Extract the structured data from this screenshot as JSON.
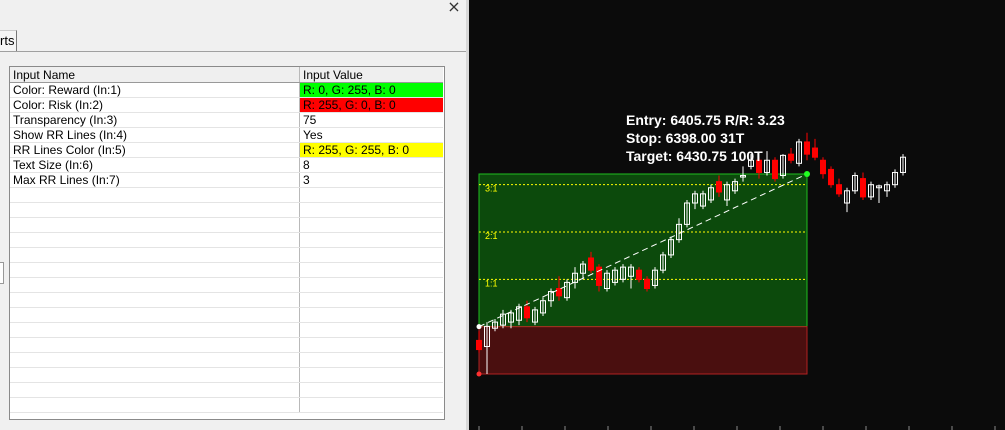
{
  "dialog": {
    "tab_label": "rts",
    "columns": [
      "Input Name",
      "Input Value"
    ],
    "rows": [
      {
        "name": "Color: Reward   (In:1)",
        "value": "R: 0, G: 255, B: 0",
        "bg": "#00ff00"
      },
      {
        "name": "Color: Risk   (In:2)",
        "value": "R: 255, G: 0, B: 0",
        "bg": "#ff0000"
      },
      {
        "name": "Transparency   (In:3)",
        "value": "75",
        "bg": ""
      },
      {
        "name": "Show RR Lines   (In:4)",
        "value": "Yes",
        "bg": ""
      },
      {
        "name": "RR Lines Color   (In:5)",
        "value": "R: 255, G: 255, B: 0",
        "bg": "#ffff00"
      },
      {
        "name": "Text Size   (In:6)",
        "value": "8",
        "bg": ""
      },
      {
        "name": "Max RR Lines   (In:7)",
        "value": "3",
        "bg": ""
      }
    ],
    "close_glyph": "×"
  },
  "chart": {
    "info_lines": [
      "Entry: 6405.75  R/R: 3.23",
      "Stop: 6398.00  31T",
      "Target: 6430.75  100T"
    ],
    "rr_labels": [
      "3:1",
      "2:1",
      "1:1"
    ],
    "entry": 6405.75,
    "stop": 6398.0,
    "target": 6430.75,
    "colors": {
      "reward_fill": "#0c4a0c",
      "reward_border": "#1fbf1f",
      "risk_fill": "#4a0f0f",
      "risk_border": "#b22020",
      "rr_line": "#ffff00",
      "up_candle": "#ffffff",
      "down_candle": "#ff0000",
      "background": "#0b0b0b"
    },
    "candles": [
      {
        "o": 6403.5,
        "h": 6405.0,
        "l": 6401.5,
        "c": 6402.0
      },
      {
        "o": 6402.5,
        "h": 6406.5,
        "l": 6398.0,
        "c": 6405.8
      },
      {
        "o": 6405.5,
        "h": 6407.0,
        "l": 6405.0,
        "c": 6406.5
      },
      {
        "o": 6406.0,
        "h": 6408.5,
        "l": 6405.5,
        "c": 6407.8
      },
      {
        "o": 6406.5,
        "h": 6408.5,
        "l": 6405.5,
        "c": 6408.0
      },
      {
        "o": 6406.8,
        "h": 6409.5,
        "l": 6406.0,
        "c": 6409.0
      },
      {
        "o": 6409.0,
        "h": 6410.0,
        "l": 6406.5,
        "c": 6407.2
      },
      {
        "o": 6406.5,
        "h": 6409.0,
        "l": 6406.0,
        "c": 6408.5
      },
      {
        "o": 6408.0,
        "h": 6410.5,
        "l": 6407.5,
        "c": 6410.0
      },
      {
        "o": 6410.0,
        "h": 6412.0,
        "l": 6409.0,
        "c": 6411.5
      },
      {
        "o": 6412.0,
        "h": 6414.0,
        "l": 6410.0,
        "c": 6410.8
      },
      {
        "o": 6410.5,
        "h": 6413.5,
        "l": 6410.0,
        "c": 6413.0
      },
      {
        "o": 6413.0,
        "h": 6415.5,
        "l": 6412.0,
        "c": 6414.5
      },
      {
        "o": 6414.5,
        "h": 6416.5,
        "l": 6413.5,
        "c": 6416.0
      },
      {
        "o": 6417.0,
        "h": 6418.0,
        "l": 6414.5,
        "c": 6415.0
      },
      {
        "o": 6415.5,
        "h": 6416.0,
        "l": 6411.5,
        "c": 6412.5
      },
      {
        "o": 6412.0,
        "h": 6415.0,
        "l": 6411.5,
        "c": 6414.5
      },
      {
        "o": 6413.0,
        "h": 6415.5,
        "l": 6412.5,
        "c": 6415.0
      },
      {
        "o": 6413.5,
        "h": 6416.0,
        "l": 6413.0,
        "c": 6415.5
      },
      {
        "o": 6414.0,
        "h": 6416.0,
        "l": 6412.0,
        "c": 6415.5
      },
      {
        "o": 6415.0,
        "h": 6415.5,
        "l": 6413.0,
        "c": 6413.5
      },
      {
        "o": 6413.5,
        "h": 6414.0,
        "l": 6411.5,
        "c": 6412.0
      },
      {
        "o": 6412.5,
        "h": 6415.5,
        "l": 6412.0,
        "c": 6415.0
      },
      {
        "o": 6415.0,
        "h": 6418.0,
        "l": 6414.5,
        "c": 6417.5
      },
      {
        "o": 6417.5,
        "h": 6420.5,
        "l": 6417.0,
        "c": 6420.0
      },
      {
        "o": 6420.0,
        "h": 6423.5,
        "l": 6419.5,
        "c": 6422.5
      },
      {
        "o": 6422.5,
        "h": 6426.5,
        "l": 6422.0,
        "c": 6426.0
      },
      {
        "o": 6426.0,
        "h": 6428.0,
        "l": 6425.0,
        "c": 6427.5
      },
      {
        "o": 6425.5,
        "h": 6428.0,
        "l": 6425.0,
        "c": 6427.5
      },
      {
        "o": 6426.5,
        "h": 6429.0,
        "l": 6426.0,
        "c": 6428.5
      },
      {
        "o": 6429.5,
        "h": 6430.5,
        "l": 6427.0,
        "c": 6427.8
      },
      {
        "o": 6426.5,
        "h": 6429.5,
        "l": 6425.5,
        "c": 6429.0
      },
      {
        "o": 6428.0,
        "h": 6430.0,
        "l": 6427.5,
        "c": 6429.5
      },
      {
        "o": 6430.5,
        "h": 6432.0,
        "l": 6429.5,
        "c": 6430.5
      },
      {
        "o": 6432.0,
        "h": 6434.0,
        "l": 6431.5,
        "c": 6433.0
      },
      {
        "o": 6433.0,
        "h": 6433.5,
        "l": 6430.0,
        "c": 6431.0
      },
      {
        "o": 6431.0,
        "h": 6434.5,
        "l": 6430.5,
        "c": 6433.0
      },
      {
        "o": 6433.0,
        "h": 6433.5,
        "l": 6429.5,
        "c": 6430.0
      },
      {
        "o": 6430.5,
        "h": 6434.0,
        "l": 6430.0,
        "c": 6433.8
      },
      {
        "o": 6434.0,
        "h": 6435.0,
        "l": 6432.5,
        "c": 6433.0
      },
      {
        "o": 6432.5,
        "h": 6436.5,
        "l": 6432.0,
        "c": 6436.0
      },
      {
        "o": 6436.0,
        "h": 6437.5,
        "l": 6433.0,
        "c": 6434.0
      },
      {
        "o": 6435.0,
        "h": 6436.5,
        "l": 6433.0,
        "c": 6433.5
      },
      {
        "o": 6433.0,
        "h": 6433.5,
        "l": 6430.0,
        "c": 6430.8
      },
      {
        "o": 6431.5,
        "h": 6432.0,
        "l": 6428.5,
        "c": 6429.0
      },
      {
        "o": 6429.0,
        "h": 6430.0,
        "l": 6427.0,
        "c": 6427.5
      },
      {
        "o": 6426.0,
        "h": 6428.5,
        "l": 6424.5,
        "c": 6428.0
      },
      {
        "o": 6428.0,
        "h": 6431.0,
        "l": 6427.5,
        "c": 6430.5
      },
      {
        "o": 6430.0,
        "h": 6431.0,
        "l": 6426.5,
        "c": 6427.0
      },
      {
        "o": 6427.0,
        "h": 6429.5,
        "l": 6426.5,
        "c": 6429.0
      },
      {
        "o": 6428.5,
        "h": 6429.0,
        "l": 6426.0,
        "c": 6428.8
      },
      {
        "o": 6428.0,
        "h": 6429.5,
        "l": 6427.0,
        "c": 6429.0
      },
      {
        "o": 6429.0,
        "h": 6431.5,
        "l": 6428.5,
        "c": 6431.0
      },
      {
        "o": 6431.0,
        "h": 6434.0,
        "l": 6430.5,
        "c": 6433.5
      }
    ]
  }
}
